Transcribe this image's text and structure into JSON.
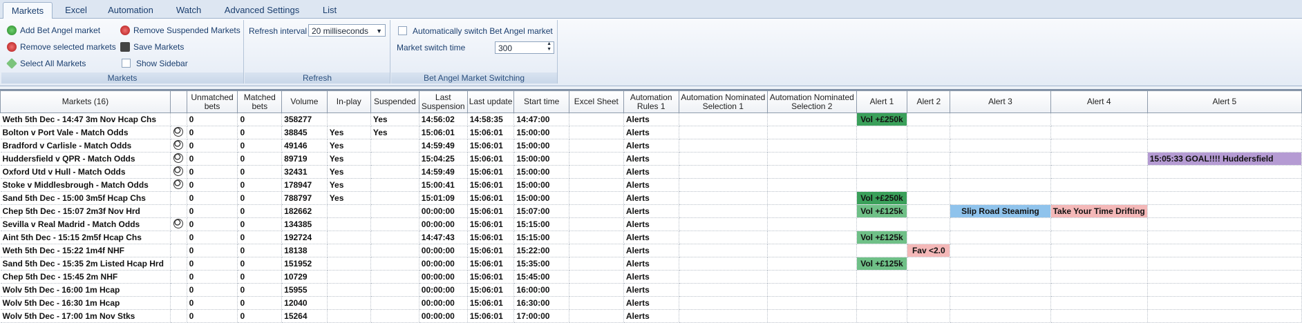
{
  "tabs": [
    "Markets",
    "Excel",
    "Automation",
    "Watch",
    "Advanced Settings",
    "List"
  ],
  "ribbon": {
    "markets": {
      "add": "Add Bet Angel market",
      "remove_selected": "Remove selected markets",
      "select_all": "Select All Markets",
      "remove_suspended": "Remove Suspended Markets",
      "save": "Save Markets",
      "show_sidebar": "Show Sidebar",
      "label": "Markets"
    },
    "refresh": {
      "interval_label": "Refresh interval",
      "interval_value": "20 milliseconds",
      "label": "Refresh"
    },
    "switching": {
      "auto_label": "Automatically switch Bet Angel market",
      "time_label": "Market switch time",
      "time_value": "300",
      "label": "Bet Angel Market Switching"
    }
  },
  "table": {
    "headers": [
      "Markets (16)",
      "",
      "Unmatched bets",
      "Matched bets",
      "Volume",
      "In-play",
      "Suspended",
      "Last Suspension",
      "Last update",
      "Start time",
      "Excel Sheet",
      "Automation Rules 1",
      "Automation Nominated Selection 1",
      "Automation Nominated Selection 2",
      "Alert 1",
      "Alert 2",
      "Alert 3",
      "Alert 4",
      "Alert 5"
    ],
    "rows": [
      {
        "market": "Weth 5th Dec - 14:47 3m Nov Hcap Chs",
        "ball": false,
        "unmatched": "0",
        "matched": "0",
        "volume": "358277",
        "inplay": "",
        "suspended": "Yes",
        "last_susp": "14:56:02",
        "last_update": "14:58:35",
        "start": "14:47:00",
        "excel": "",
        "rules": "Alerts",
        "nom1": "",
        "nom2": "",
        "a1": "Vol +£250k",
        "a2": "",
        "a3": "",
        "a4": "",
        "a5": ""
      },
      {
        "market": "Bolton v Port Vale - Match Odds",
        "ball": true,
        "unmatched": "0",
        "matched": "0",
        "volume": "38845",
        "inplay": "Yes",
        "suspended": "Yes",
        "last_susp": "15:06:01",
        "last_update": "15:06:01",
        "start": "15:00:00",
        "excel": "",
        "rules": "Alerts",
        "nom1": "",
        "nom2": "",
        "a1": "",
        "a2": "",
        "a3": "",
        "a4": "",
        "a5": ""
      },
      {
        "market": "Bradford v Carlisle - Match Odds",
        "ball": true,
        "unmatched": "0",
        "matched": "0",
        "volume": "49146",
        "inplay": "Yes",
        "suspended": "",
        "last_susp": "14:59:49",
        "last_update": "15:06:01",
        "start": "15:00:00",
        "excel": "",
        "rules": "Alerts",
        "nom1": "",
        "nom2": "",
        "a1": "",
        "a2": "",
        "a3": "",
        "a4": "",
        "a5": ""
      },
      {
        "market": "Huddersfield v QPR - Match Odds",
        "ball": true,
        "unmatched": "0",
        "matched": "0",
        "volume": "89719",
        "inplay": "Yes",
        "suspended": "",
        "last_susp": "15:04:25",
        "last_update": "15:06:01",
        "start": "15:00:00",
        "excel": "",
        "rules": "Alerts",
        "nom1": "",
        "nom2": "",
        "a1": "",
        "a2": "",
        "a3": "",
        "a4": "",
        "a5": "15:05:33 GOAL!!!! Huddersfield"
      },
      {
        "market": "Oxford Utd v Hull - Match Odds",
        "ball": true,
        "unmatched": "0",
        "matched": "0",
        "volume": "32431",
        "inplay": "Yes",
        "suspended": "",
        "last_susp": "14:59:49",
        "last_update": "15:06:01",
        "start": "15:00:00",
        "excel": "",
        "rules": "Alerts",
        "nom1": "",
        "nom2": "",
        "a1": "",
        "a2": "",
        "a3": "",
        "a4": "",
        "a5": ""
      },
      {
        "market": "Stoke v Middlesbrough - Match Odds",
        "ball": true,
        "unmatched": "0",
        "matched": "0",
        "volume": "178947",
        "inplay": "Yes",
        "suspended": "",
        "last_susp": "15:00:41",
        "last_update": "15:06:01",
        "start": "15:00:00",
        "excel": "",
        "rules": "Alerts",
        "nom1": "",
        "nom2": "",
        "a1": "",
        "a2": "",
        "a3": "",
        "a4": "",
        "a5": ""
      },
      {
        "market": "Sand 5th Dec - 15:00 3m5f Hcap Chs",
        "ball": false,
        "unmatched": "0",
        "matched": "0",
        "volume": "788797",
        "inplay": "Yes",
        "suspended": "",
        "last_susp": "15:01:09",
        "last_update": "15:06:01",
        "start": "15:00:00",
        "excel": "",
        "rules": "Alerts",
        "nom1": "",
        "nom2": "",
        "a1": "Vol +£250k",
        "a2": "",
        "a3": "",
        "a4": "",
        "a5": ""
      },
      {
        "market": "Chep 5th Dec - 15:07 2m3f Nov Hrd",
        "ball": false,
        "unmatched": "0",
        "matched": "0",
        "volume": "182662",
        "inplay": "",
        "suspended": "",
        "last_susp": "00:00:00",
        "last_update": "15:06:01",
        "start": "15:07:00",
        "excel": "",
        "rules": "Alerts",
        "nom1": "",
        "nom2": "",
        "a1": "Vol +£125k",
        "a2": "",
        "a3": "Slip Road Steaming",
        "a4": "Take Your Time Drifting",
        "a5": ""
      },
      {
        "market": "Sevilla v Real Madrid - Match Odds",
        "ball": true,
        "unmatched": "0",
        "matched": "0",
        "volume": "134385",
        "inplay": "",
        "suspended": "",
        "last_susp": "00:00:00",
        "last_update": "15:06:01",
        "start": "15:15:00",
        "excel": "",
        "rules": "Alerts",
        "nom1": "",
        "nom2": "",
        "a1": "",
        "a2": "",
        "a3": "",
        "a4": "",
        "a5": ""
      },
      {
        "market": "Aint 5th Dec - 15:15 2m5f Hcap Chs",
        "ball": false,
        "unmatched": "0",
        "matched": "0",
        "volume": "192724",
        "inplay": "",
        "suspended": "",
        "last_susp": "14:47:43",
        "last_update": "15:06:01",
        "start": "15:15:00",
        "excel": "",
        "rules": "Alerts",
        "nom1": "",
        "nom2": "",
        "a1": "Vol +£125k",
        "a2": "",
        "a3": "",
        "a4": "",
        "a5": ""
      },
      {
        "market": "Weth 5th Dec - 15:22 1m4f NHF",
        "ball": false,
        "unmatched": "0",
        "matched": "0",
        "volume": "18138",
        "inplay": "",
        "suspended": "",
        "last_susp": "00:00:00",
        "last_update": "15:06:01",
        "start": "15:22:00",
        "excel": "",
        "rules": "Alerts",
        "nom1": "",
        "nom2": "",
        "a1": "",
        "a2": "Fav <2.0",
        "a3": "",
        "a4": "",
        "a5": ""
      },
      {
        "market": "Sand 5th Dec - 15:35 2m Listed Hcap Hrd",
        "ball": false,
        "unmatched": "0",
        "matched": "0",
        "volume": "151952",
        "inplay": "",
        "suspended": "",
        "last_susp": "00:00:00",
        "last_update": "15:06:01",
        "start": "15:35:00",
        "excel": "",
        "rules": "Alerts",
        "nom1": "",
        "nom2": "",
        "a1": "Vol +£125k",
        "a2": "",
        "a3": "",
        "a4": "",
        "a5": ""
      },
      {
        "market": "Chep 5th Dec - 15:45 2m NHF",
        "ball": false,
        "unmatched": "0",
        "matched": "0",
        "volume": "10729",
        "inplay": "",
        "suspended": "",
        "last_susp": "00:00:00",
        "last_update": "15:06:01",
        "start": "15:45:00",
        "excel": "",
        "rules": "Alerts",
        "nom1": "",
        "nom2": "",
        "a1": "",
        "a2": "",
        "a3": "",
        "a4": "",
        "a5": ""
      },
      {
        "market": "Wolv 5th Dec - 16:00 1m Hcap",
        "ball": false,
        "unmatched": "0",
        "matched": "0",
        "volume": "15955",
        "inplay": "",
        "suspended": "",
        "last_susp": "00:00:00",
        "last_update": "15:06:01",
        "start": "16:00:00",
        "excel": "",
        "rules": "Alerts",
        "nom1": "",
        "nom2": "",
        "a1": "",
        "a2": "",
        "a3": "",
        "a4": "",
        "a5": ""
      },
      {
        "market": "Wolv 5th Dec - 16:30 1m Hcap",
        "ball": false,
        "unmatched": "0",
        "matched": "0",
        "volume": "12040",
        "inplay": "",
        "suspended": "",
        "last_susp": "00:00:00",
        "last_update": "15:06:01",
        "start": "16:30:00",
        "excel": "",
        "rules": "Alerts",
        "nom1": "",
        "nom2": "",
        "a1": "",
        "a2": "",
        "a3": "",
        "a4": "",
        "a5": ""
      },
      {
        "market": "Wolv 5th Dec - 17:00 1m Nov Stks",
        "ball": false,
        "unmatched": "0",
        "matched": "0",
        "volume": "15264",
        "inplay": "",
        "suspended": "",
        "last_susp": "00:00:00",
        "last_update": "15:06:01",
        "start": "17:00:00",
        "excel": "",
        "rules": "Alerts",
        "nom1": "",
        "nom2": "",
        "a1": "",
        "a2": "",
        "a3": "",
        "a4": "",
        "a5": ""
      }
    ]
  },
  "colors": {
    "green_dark": "#3aa05a",
    "green_light": "#6fc087",
    "pink": "#f4b8b8",
    "blue": "#8fc3ec",
    "purple": "#b59bd3",
    "ball_icon": "soccer-ball-icon"
  }
}
